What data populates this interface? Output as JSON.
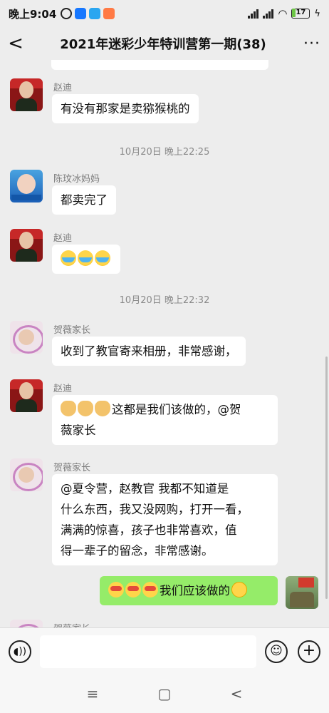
{
  "status": {
    "time": "晚上9:04",
    "battery": "17"
  },
  "nav": {
    "back": "<",
    "title": "2021年迷彩少年特训营第一期(38)",
    "more": "···"
  },
  "messages": {
    "m1": {
      "sender": "赵迪",
      "text": "有没有那家是卖猕猴桃的"
    },
    "ts1": "10月20日 晚上22:25",
    "m2": {
      "sender": "陈玟冰妈妈",
      "text": "都卖完了"
    },
    "m3": {
      "sender": "赵迪"
    },
    "ts2": "10月20日 晚上22:32",
    "m4": {
      "sender": "贺薇家长",
      "text": "收到了教官寄来相册，非常感谢，"
    },
    "m5": {
      "sender": "赵迪",
      "text_line1": "这都是我们该做的，@贺",
      "text_line2": "薇家长"
    },
    "m6": {
      "sender": "贺薇家长",
      "lines": [
        "@夏令营，赵教官  我都不知道是",
        "什么东西，我又没网购，打开一看，",
        "满满的惊喜，孩子也非常喜欢，值",
        "得一辈子的留念，非常感谢。"
      ]
    },
    "m7": {
      "text": "我们应该做的"
    },
    "m8": {
      "sender": "贺薇家长"
    }
  },
  "icons": {
    "voice": "voice-icon",
    "emoji": "emoji-icon",
    "plus": "plus-icon"
  },
  "sysnav": {
    "menu": "≡",
    "home": "▢",
    "back": "<"
  }
}
